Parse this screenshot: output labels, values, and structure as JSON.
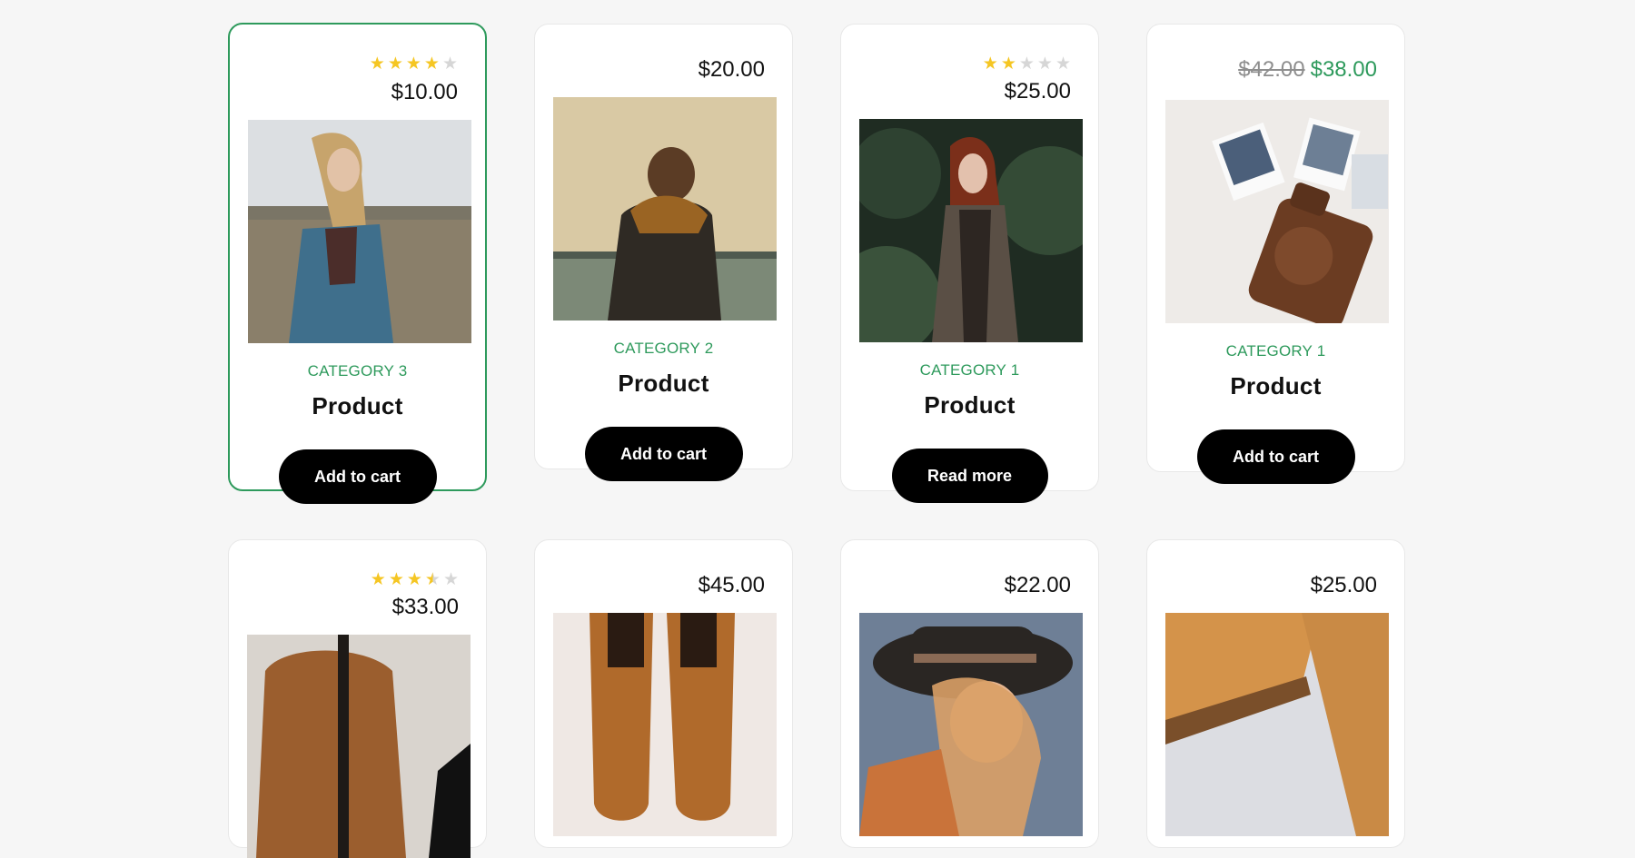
{
  "products": [
    {
      "category": "CATEGORY 3",
      "title": "Product",
      "price": "$10.00",
      "rating": 4,
      "button": "Add to cart"
    },
    {
      "category": "CATEGORY 2",
      "title": "Product",
      "price": "$20.00",
      "button": "Add to cart"
    },
    {
      "category": "CATEGORY 1",
      "title": "Product",
      "price": "$25.00",
      "rating": 2,
      "button": "Read more"
    },
    {
      "category": "CATEGORY 1",
      "title": "Product",
      "old_price": "$42.00",
      "price": "$38.00",
      "button": "Add to cart"
    },
    {
      "price": "$33.00",
      "rating": 3.5
    },
    {
      "price": "$45.00"
    },
    {
      "price": "$22.00"
    },
    {
      "price": "$25.00"
    }
  ],
  "colors": {
    "accent": "#2e9a5c",
    "star_on": "#f5c623",
    "star_off": "#d6d6d6",
    "button_bg": "#000000",
    "page_bg": "#f6f6f6"
  },
  "icons": {
    "star": "star-icon"
  }
}
